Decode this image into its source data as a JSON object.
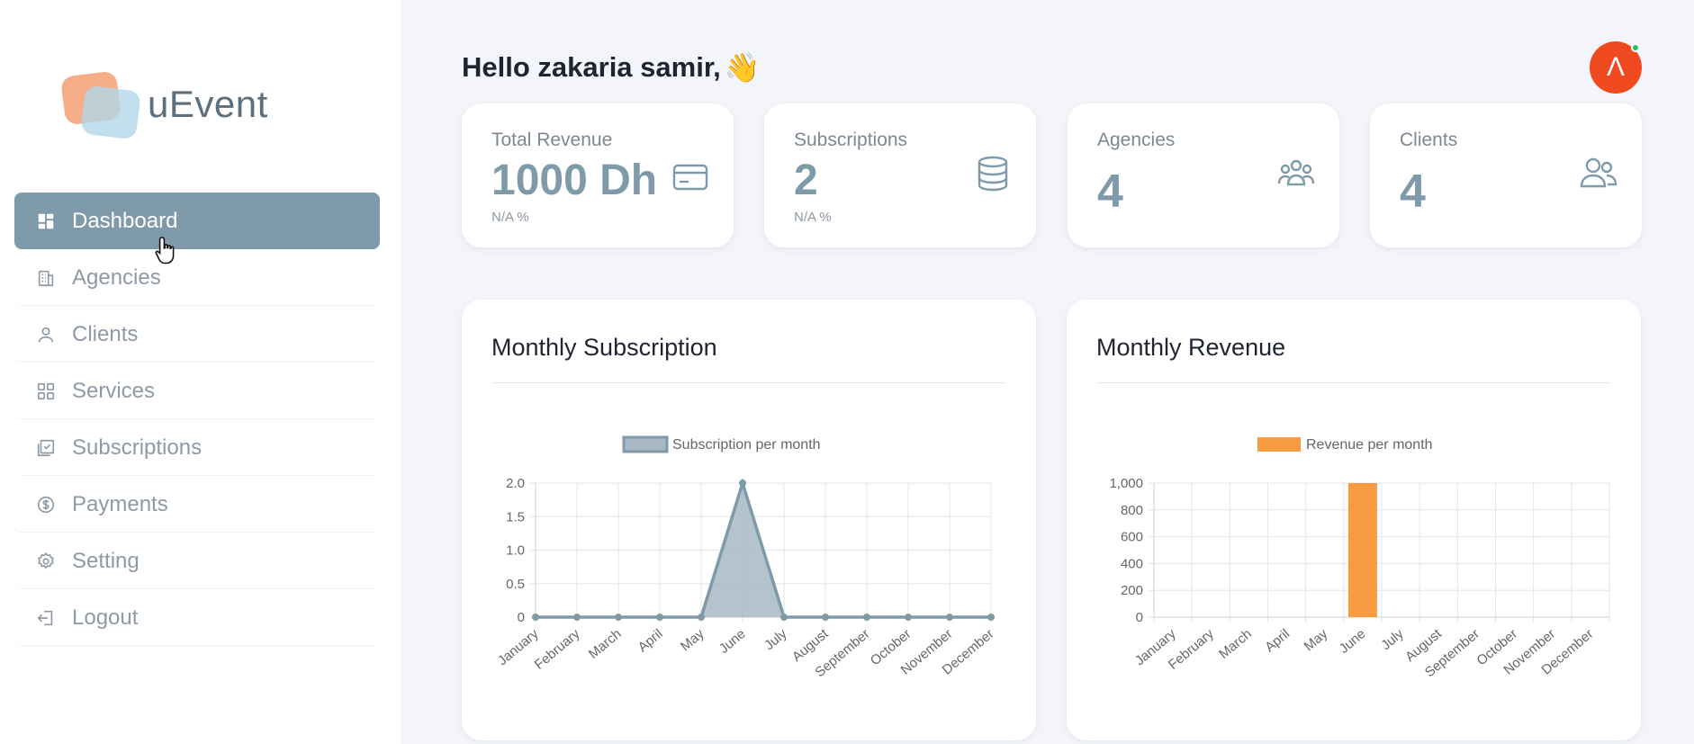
{
  "brand": {
    "name": "uEvent"
  },
  "sidebar": {
    "items": [
      {
        "label": "Dashboard",
        "icon": "dashboard-icon",
        "active": true
      },
      {
        "label": "Agencies",
        "icon": "building-icon",
        "active": false
      },
      {
        "label": "Clients",
        "icon": "user-icon",
        "active": false
      },
      {
        "label": "Services",
        "icon": "grid-icon",
        "active": false
      },
      {
        "label": "Subscriptions",
        "icon": "checklist-icon",
        "active": false
      },
      {
        "label": "Payments",
        "icon": "dollar-icon",
        "active": false
      },
      {
        "label": "Setting",
        "icon": "gear-icon",
        "active": false
      },
      {
        "label": "Logout",
        "icon": "logout-icon",
        "active": false
      }
    ]
  },
  "header": {
    "greeting": "Hello zakaria samir,",
    "wave_emoji": "👋",
    "avatar_letter": "Λ",
    "avatar_color": "#ef4a20"
  },
  "stats": [
    {
      "label": "Total Revenue",
      "value": "1000 Dh",
      "sub": "N/A %",
      "icon": "credit-card-icon"
    },
    {
      "label": "Subscriptions",
      "value": "2",
      "sub": "N/A %",
      "icon": "database-icon"
    },
    {
      "label": "Agencies",
      "value": "4",
      "sub": "",
      "icon": "group-icon"
    },
    {
      "label": "Clients",
      "value": "4",
      "sub": "",
      "icon": "users-icon"
    }
  ],
  "colors": {
    "accent": "#7f9aa9",
    "subscription_line": "#7f9aa9",
    "subscription_fill": "#a7b8c3",
    "revenue_bar": "#f89c43"
  },
  "chart_data": [
    {
      "type": "area",
      "title": "Monthly Subscription",
      "legend": "Subscription per month",
      "categories": [
        "January",
        "February",
        "March",
        "April",
        "May",
        "June",
        "July",
        "August",
        "September",
        "October",
        "November",
        "December"
      ],
      "values": [
        0,
        0,
        0,
        0,
        0,
        2,
        0,
        0,
        0,
        0,
        0,
        0
      ],
      "ylim": [
        0,
        2
      ],
      "yticks": [
        "0",
        "0.5",
        "1.0",
        "1.5",
        "2.0"
      ],
      "grid": true,
      "legend_position": "top"
    },
    {
      "type": "bar",
      "title": "Monthly Revenue",
      "legend": "Revenue per month",
      "categories": [
        "January",
        "February",
        "March",
        "April",
        "May",
        "June",
        "July",
        "August",
        "September",
        "October",
        "November",
        "December"
      ],
      "values": [
        0,
        0,
        0,
        0,
        0,
        1000,
        0,
        0,
        0,
        0,
        0,
        0
      ],
      "ylim": [
        0,
        1000
      ],
      "yticks": [
        "0",
        "200",
        "400",
        "600",
        "800",
        "1,000"
      ],
      "grid": true,
      "legend_position": "top"
    }
  ]
}
